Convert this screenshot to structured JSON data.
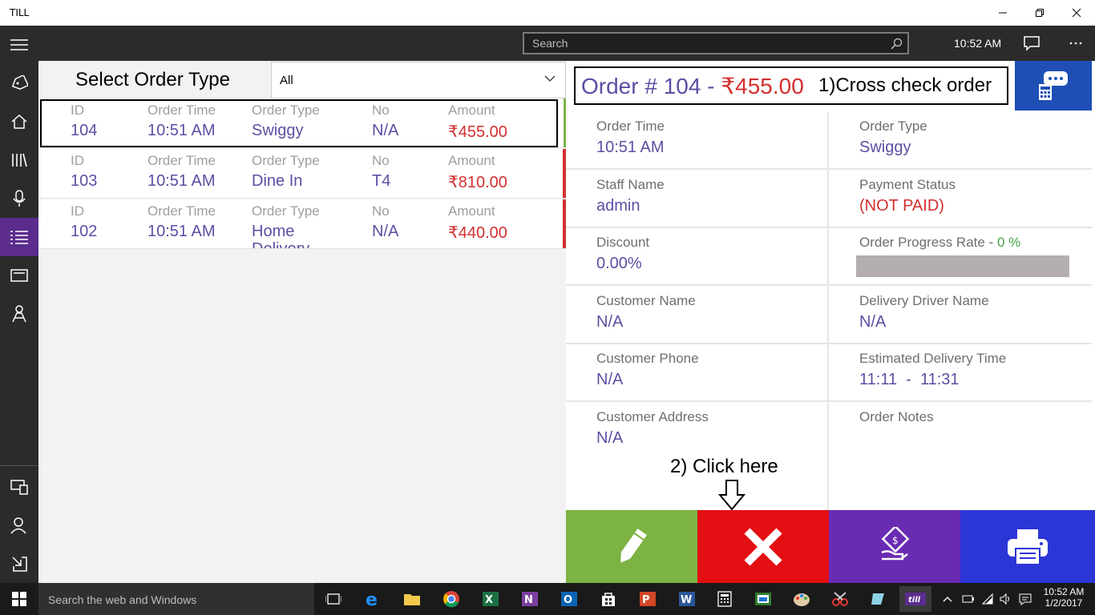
{
  "window": {
    "title": "TILL"
  },
  "topbar": {
    "search_placeholder": "Search",
    "clock": "10:52 AM"
  },
  "left": {
    "select_title": "Select Order Type",
    "select_value": "All",
    "columns": {
      "id": "ID",
      "time": "Order Time",
      "type": "Order Type",
      "no": "No",
      "amount": "Amount"
    },
    "orders": [
      {
        "id": "104",
        "time": "10:51 AM",
        "type": "Swiggy",
        "no": "N/A",
        "amount": "₹455.00"
      },
      {
        "id": "103",
        "time": "10:51 AM",
        "type": "Dine In",
        "no": "T4",
        "amount": "₹810.00"
      },
      {
        "id": "102",
        "time": "10:51 AM",
        "type": "Home Delivery",
        "no": "N/A",
        "amount": "₹440.00"
      }
    ]
  },
  "right": {
    "header_prefix": "Order # 104 - ",
    "header_amount": "₹455.00",
    "annotation_1": "1)Cross check order",
    "annotation_2": "2) Click here",
    "fields": {
      "order_time_label": "Order Time",
      "order_time": "10:51 AM",
      "order_type_label": "Order Type",
      "order_type": "Swiggy",
      "staff_label": "Staff Name",
      "staff": "admin",
      "payment_label": "Payment Status",
      "payment": "(NOT PAID)",
      "discount_label": "Discount",
      "discount": "0.00%",
      "progress_label": "Order Progress Rate - ",
      "progress_pct": "0 %",
      "customer_name_label": "Customer Name",
      "customer_name": "N/A",
      "driver_label": "Delivery Driver Name",
      "driver": "N/A",
      "phone_label": "Customer Phone",
      "phone": "N/A",
      "eta_label": "Estimated Delivery Time",
      "eta": "11:11  -  11:31",
      "address_label": "Customer Address",
      "address": "N/A",
      "notes_label": "Order Notes"
    },
    "progress_fraction": 0
  },
  "taskbar": {
    "search_placeholder": "Search the web and Windows",
    "time": "10:52 AM",
    "date": "1/2/2017"
  },
  "colors": {
    "accent": "#5b2c8e",
    "edit": "#7cb342",
    "cancel": "#e30f12",
    "pay": "#6a2bb3",
    "print": "#2c36d6",
    "price": "#d32f2f",
    "value": "#5b4fa3"
  }
}
